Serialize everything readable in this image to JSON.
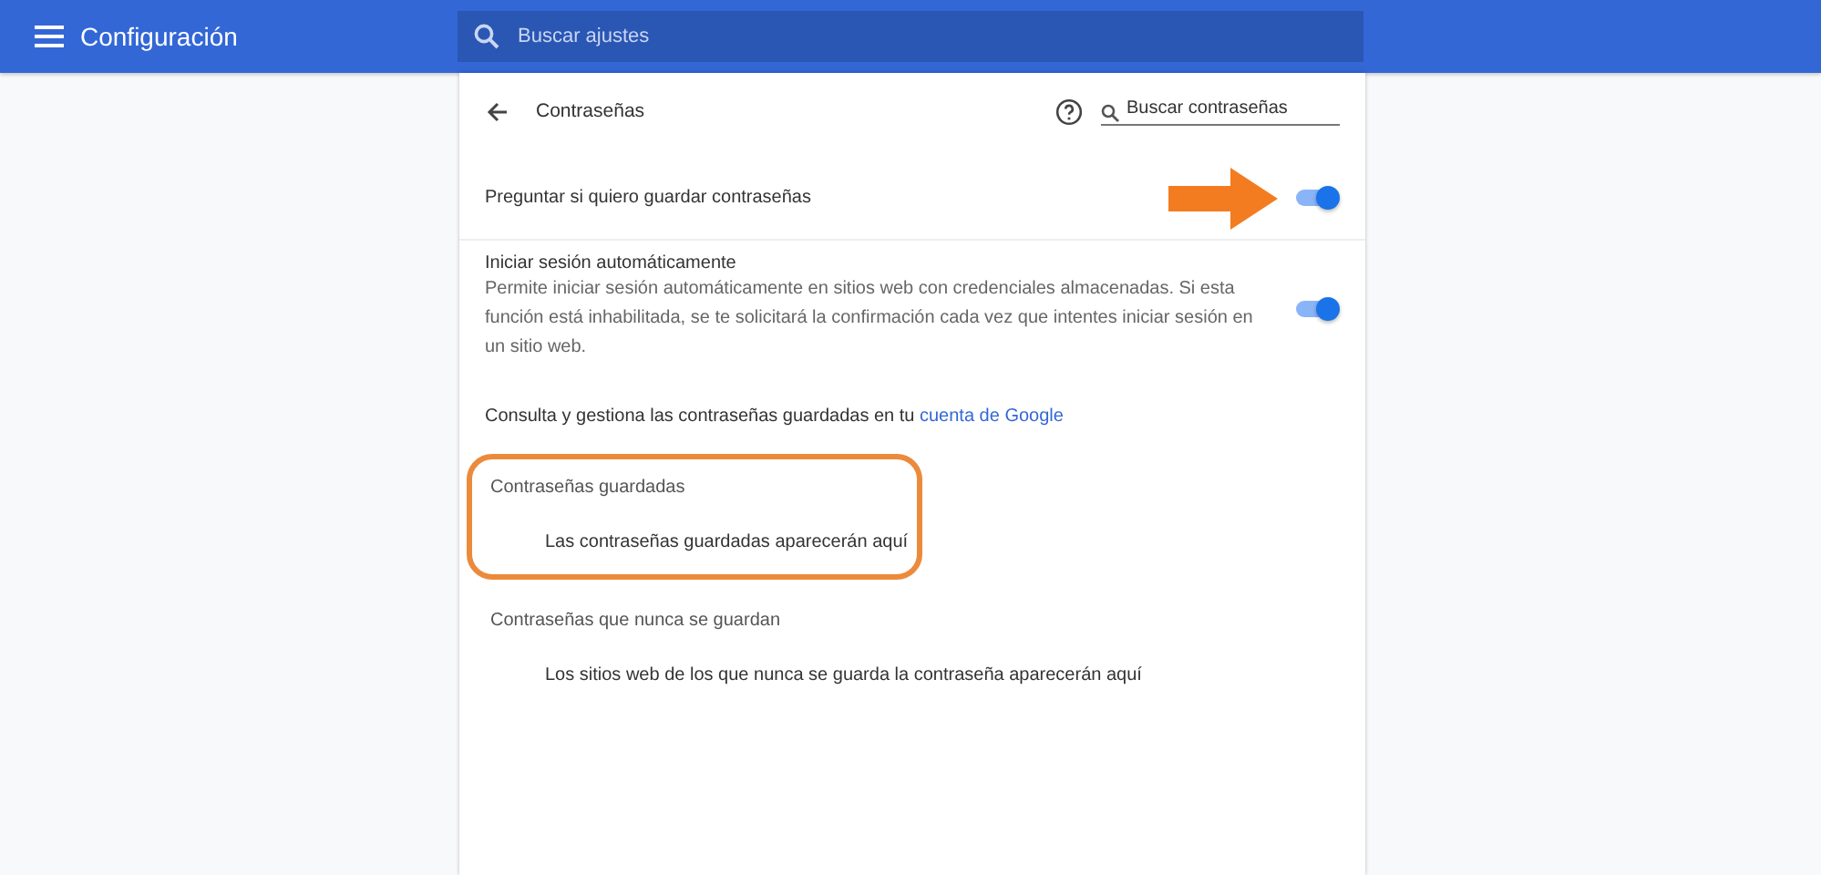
{
  "toolbar": {
    "title": "Configuración",
    "search": {
      "placeholder": "Buscar ajustes"
    }
  },
  "subpage": {
    "title": "Contraseñas",
    "search": {
      "placeholder": "Buscar contraseñas"
    }
  },
  "settings": [
    {
      "label": "Preguntar si quiero guardar contraseñas",
      "on": true,
      "arrow": true
    },
    {
      "label": "Iniciar sesión automáticamente",
      "description": "Permite iniciar sesión automáticamente en sitios web con credenciales almacenadas. Si esta función está inhabilitada, se te solicitará la confirmación cada vez que intentes iniciar sesión en un sitio web.",
      "on": true,
      "arrow": false
    }
  ],
  "account_note": {
    "text": "Consulta y gestiona las contraseñas guardadas en tu",
    "link": "cuenta de Google"
  },
  "sections": [
    {
      "title": "Contraseñas guardadas",
      "empty_text": "Las contraseñas guardadas aparecerán aquí",
      "highlighted": true
    },
    {
      "title": "Contraseñas que nunca se guardan",
      "empty_text": "Los sitios web de los que nunca se guarda la contraseña aparecerán aquí",
      "highlighted": false
    }
  ]
}
